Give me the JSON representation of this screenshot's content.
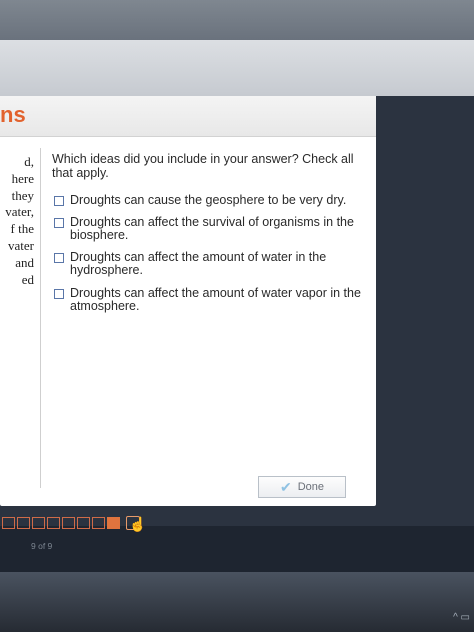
{
  "header": {
    "title_fragment": "ns"
  },
  "left_fragment_lines": [
    "d,",
    "here",
    "they",
    "vater,",
    "f the",
    "vater",
    "and",
    "ed"
  ],
  "question": {
    "text": "Which ideas did you include in your answer? Check all that apply."
  },
  "options": [
    {
      "label": "Droughts can cause the geosphere to be very dry.",
      "checked": false
    },
    {
      "label": "Droughts can affect the survival of organisms in the biosphere.",
      "checked": false
    },
    {
      "label": "Droughts can affect the amount of water in the hydrosphere.",
      "checked": false
    },
    {
      "label": "Droughts can affect the amount of water vapor in the atmosphere.",
      "checked": false
    }
  ],
  "done_button": {
    "label": "Done",
    "icon": "checkmark-icon"
  },
  "progress": {
    "total": 9,
    "current": 9,
    "label": "9 of 9"
  },
  "colors": {
    "accent": "#e2622d",
    "checkbox_border": "#5a76a8",
    "done_check": "#8fc2e3"
  }
}
